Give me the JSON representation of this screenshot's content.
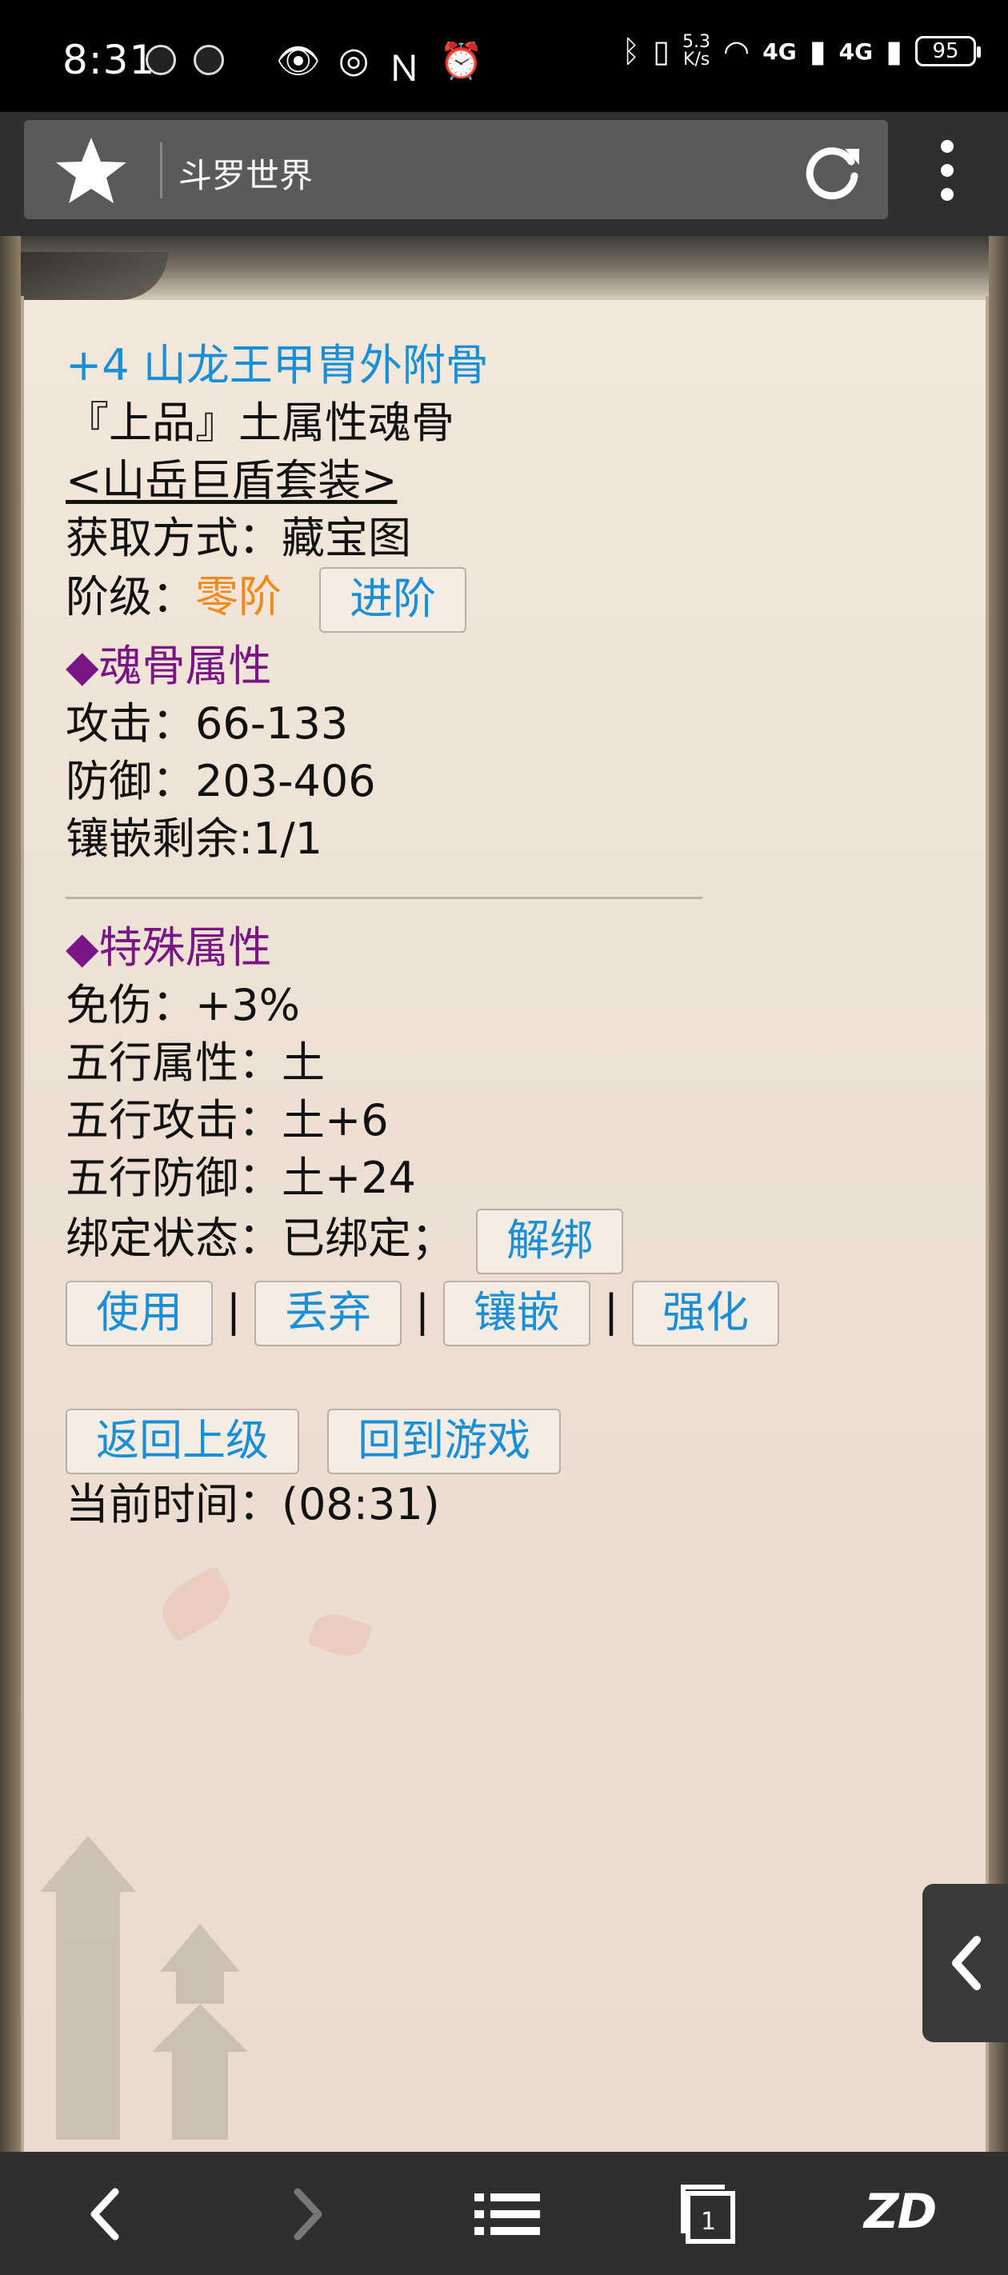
{
  "status_bar": {
    "time": "8:31",
    "net_speed_value": "5.3",
    "net_speed_unit": "K/s",
    "sim1": "4G",
    "sim2": "4G",
    "battery": "95"
  },
  "browser": {
    "site_title": "斗罗世界",
    "icons": [
      "star-icon",
      "reload-icon",
      "overflow-menu-icon"
    ]
  },
  "item": {
    "title": "+4 山龙王甲胄外附骨",
    "quality": "『上品』土属性魂骨",
    "set_link": "<山岳巨盾套装>",
    "source_label": "获取方式：",
    "source_value": "藏宝图",
    "rank_label": "阶级：",
    "rank_value": "零阶",
    "advance_button": "进阶"
  },
  "soul_bone_attrs": {
    "heading": "◆魂骨属性",
    "attack_label": "攻击：",
    "attack_value": "66-133",
    "defense_label": "防御：",
    "defense_value": "203-406",
    "inlay_label": "镶嵌剩余:",
    "inlay_value": "1/1"
  },
  "special_attrs": {
    "heading": "◆特殊属性",
    "damage_reduction_label": "免伤：",
    "damage_reduction_value": "+3%",
    "element_label": "五行属性：",
    "element_value": "土",
    "element_attack_label": "五行攻击：",
    "element_attack_value": "土+6",
    "element_defense_label": "五行防御：",
    "element_defense_value": "土+24",
    "bind_label": "绑定状态：",
    "bind_value": "已绑定；",
    "unbind_button": "解绑"
  },
  "actions": {
    "use": "使用",
    "discard": "丢弃",
    "inlay": "镶嵌",
    "enhance": "强化",
    "separator": "|"
  },
  "navigation": {
    "back": "返回上级",
    "return_game": "回到游戏"
  },
  "footer": {
    "time_label": "当前时间：",
    "time_value": "(08:31)"
  },
  "bottom_nav": {
    "tabs_count": "1",
    "logo": "ZD"
  },
  "colors": {
    "link_blue": "#1a8fd6",
    "rank_orange": "#f08a1c",
    "heading_purple": "#7a1586",
    "page_bg": "#f2e8db",
    "toolbar_bg": "#2f2f2f"
  }
}
